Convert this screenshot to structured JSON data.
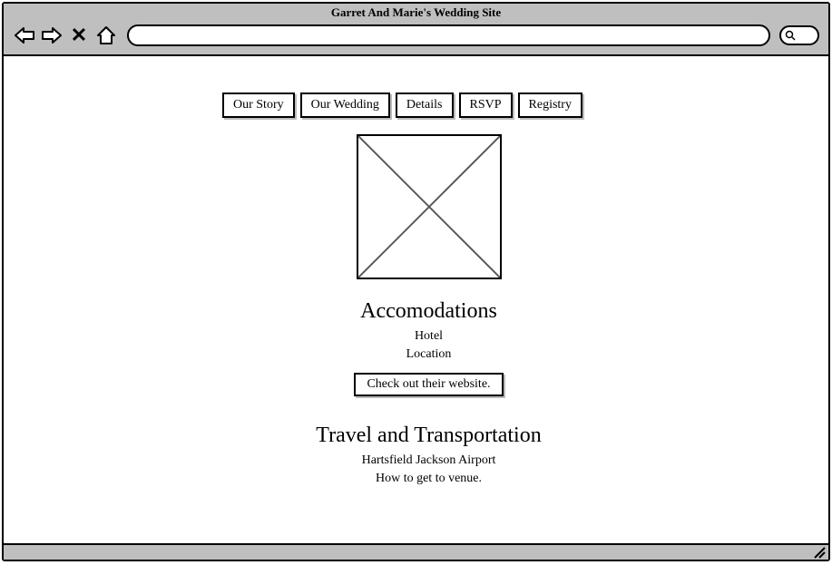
{
  "window": {
    "title": "Garret And Marie's Wedding Site"
  },
  "tabs": [
    "Our Story",
    "Our Wedding",
    "Details",
    "RSVP",
    "Registry"
  ],
  "accommodations": {
    "heading": "Accomodations",
    "line1": "Hotel",
    "line2": "Location",
    "cta": "Check out their website."
  },
  "travel": {
    "heading": "Travel and Transportation",
    "line1": "Hartsfield Jackson Airport",
    "line2": "How to get to venue."
  }
}
